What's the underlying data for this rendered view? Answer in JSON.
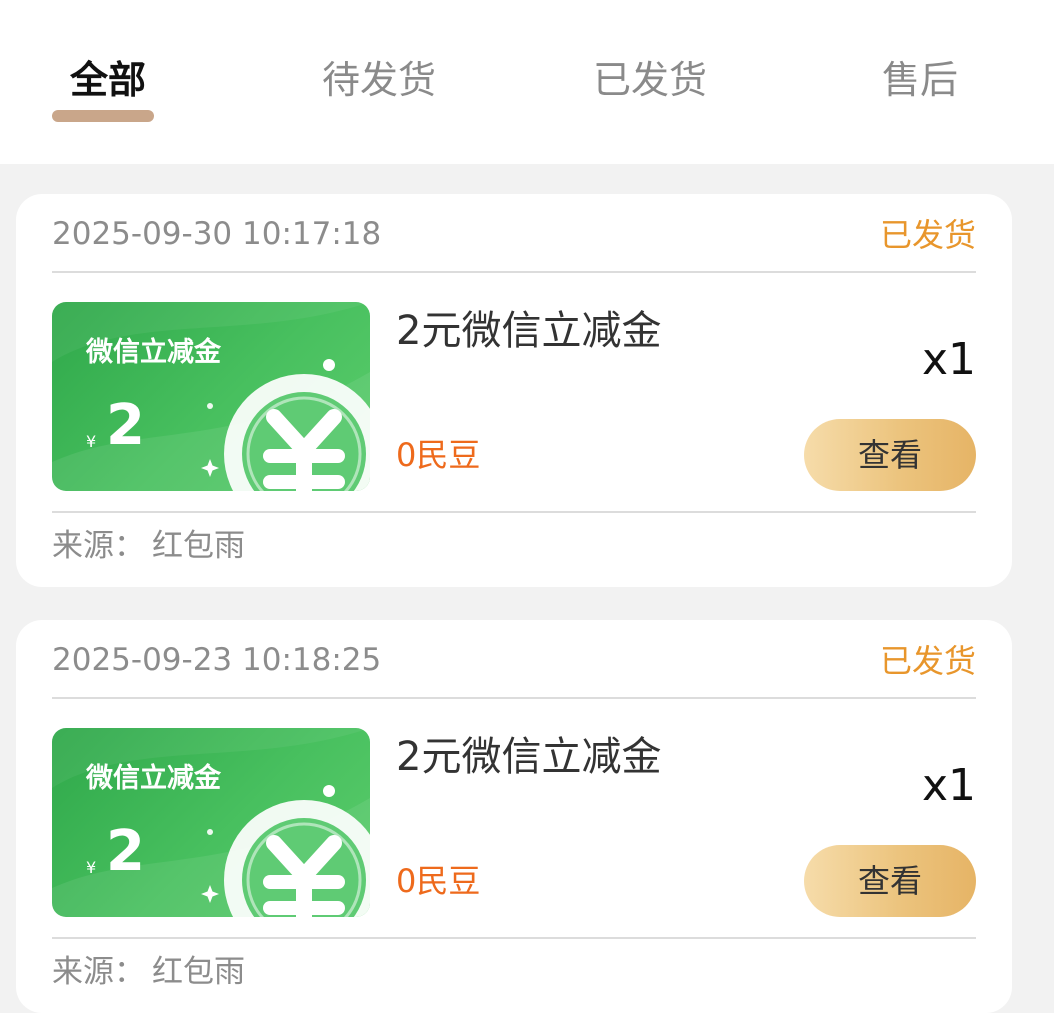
{
  "tabs": [
    {
      "label": "全部",
      "active": true
    },
    {
      "label": "待发货",
      "active": false
    },
    {
      "label": "已发货",
      "active": false
    },
    {
      "label": "售后",
      "active": false
    }
  ],
  "orders": [
    {
      "time": "2025-09-30 10:17:18",
      "status": "已发货",
      "voucher": {
        "title": "微信立减金",
        "currency": "¥",
        "amount": "2"
      },
      "product_name": "2元微信立减金",
      "quantity": "x1",
      "price": "0民豆",
      "view_label": "查看",
      "source_label": "来源：",
      "source_value": "红包雨"
    },
    {
      "time": "2025-09-23 10:18:25",
      "status": "已发货",
      "voucher": {
        "title": "微信立减金",
        "currency": "¥",
        "amount": "2"
      },
      "product_name": "2元微信立减金",
      "quantity": "x1",
      "price": "0民豆",
      "view_label": "查看",
      "source_label": "来源：",
      "source_value": "红包雨"
    }
  ],
  "colors": {
    "accent_underline": "#c9a68a",
    "status": "#e8962c",
    "price": "#ee6a1c",
    "voucher_green": "#48c05f",
    "button_gold": "#ecc47e"
  },
  "icons": [
    "coin-yuan-icon",
    "sparkle-icon"
  ]
}
